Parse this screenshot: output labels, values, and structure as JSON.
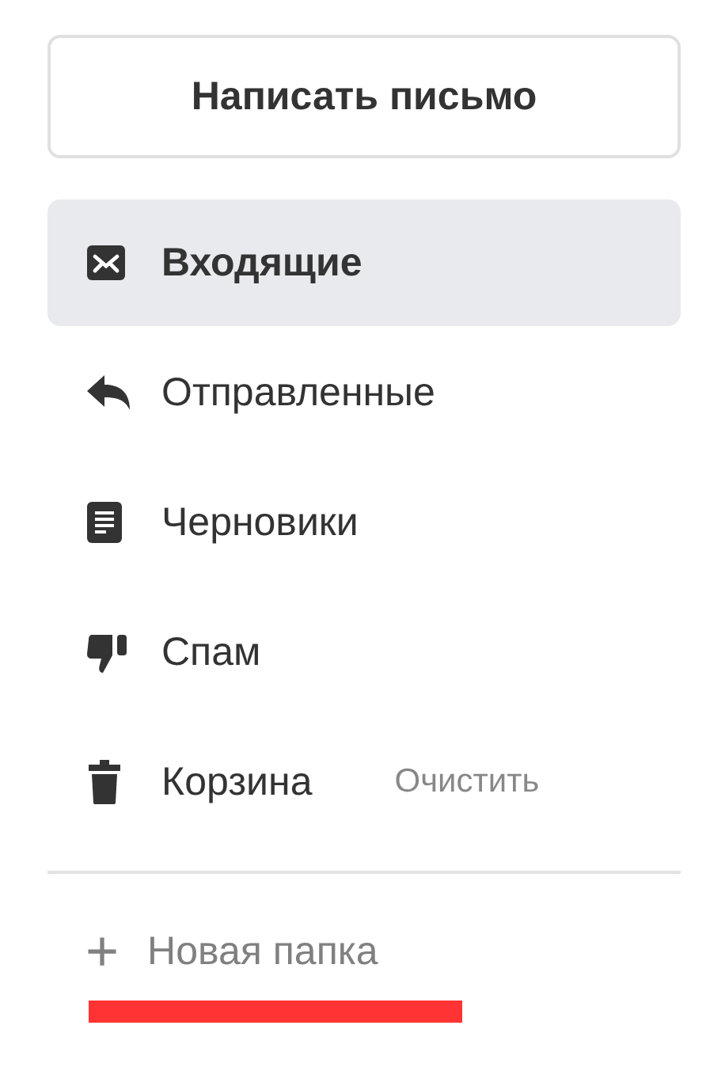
{
  "compose_button": {
    "label": "Написать письмо"
  },
  "folders": [
    {
      "kind": "inbox",
      "label": "Входящие",
      "selected": true
    },
    {
      "kind": "sent",
      "label": "Отправленные",
      "selected": false
    },
    {
      "kind": "drafts",
      "label": "Черновики",
      "selected": false
    },
    {
      "kind": "spam",
      "label": "Спам",
      "selected": false
    },
    {
      "kind": "trash",
      "label": "Корзина",
      "selected": false,
      "action": "Очистить"
    }
  ],
  "new_folder": {
    "icon": "+",
    "label": "Новая папка"
  }
}
